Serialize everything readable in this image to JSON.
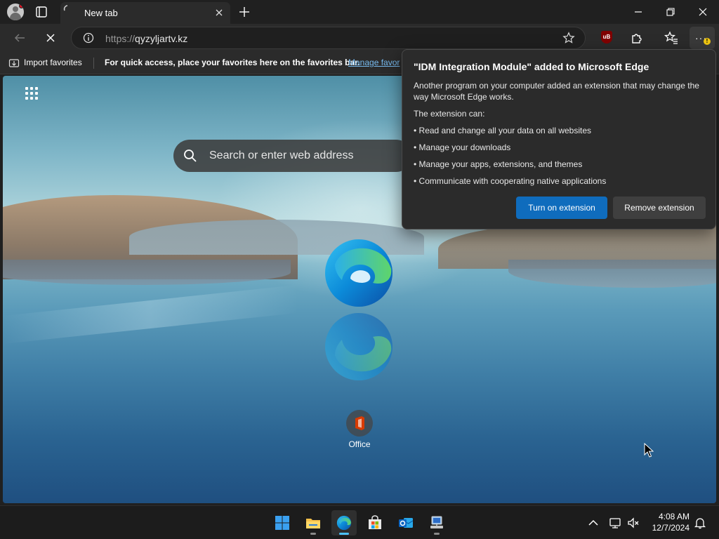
{
  "tab": {
    "title": "New tab"
  },
  "address_bar": {
    "scheme": "https://",
    "host": "qyzyljartv.kz"
  },
  "favorites_bar": {
    "import_label": "Import favorites",
    "message": "For quick access, place your favorites here on the favorites bar.",
    "manage_link": "Manage favor"
  },
  "new_tab_page": {
    "search_placeholder": "Search or enter web address",
    "quick_link": {
      "label": "Office"
    }
  },
  "popup": {
    "title": "\"IDM Integration Module\" added to Microsoft Edge",
    "description": "Another program on your computer added an extension that may change the way Microsoft Edge works.",
    "can_heading": "The extension can:",
    "permissions": [
      "• Read and change all your data on all websites",
      "• Manage your downloads",
      "• Manage your apps, extensions, and themes",
      "• Communicate with cooperating native applications"
    ],
    "primary_button": "Turn on extension",
    "secondary_button": "Remove extension"
  },
  "extensions": {
    "ublock_badge": "uB"
  },
  "taskbar": {
    "apps": [
      "start-icon",
      "file-explorer-icon",
      "edge-icon",
      "store-icon",
      "outlook-icon",
      "network-app-icon"
    ],
    "time": "4:08 AM",
    "date": "12/7/2024"
  },
  "colors": {
    "accent_button": "#0f6cbd",
    "link": "#76b9ed",
    "active_indicator": "#4cc2ff"
  }
}
